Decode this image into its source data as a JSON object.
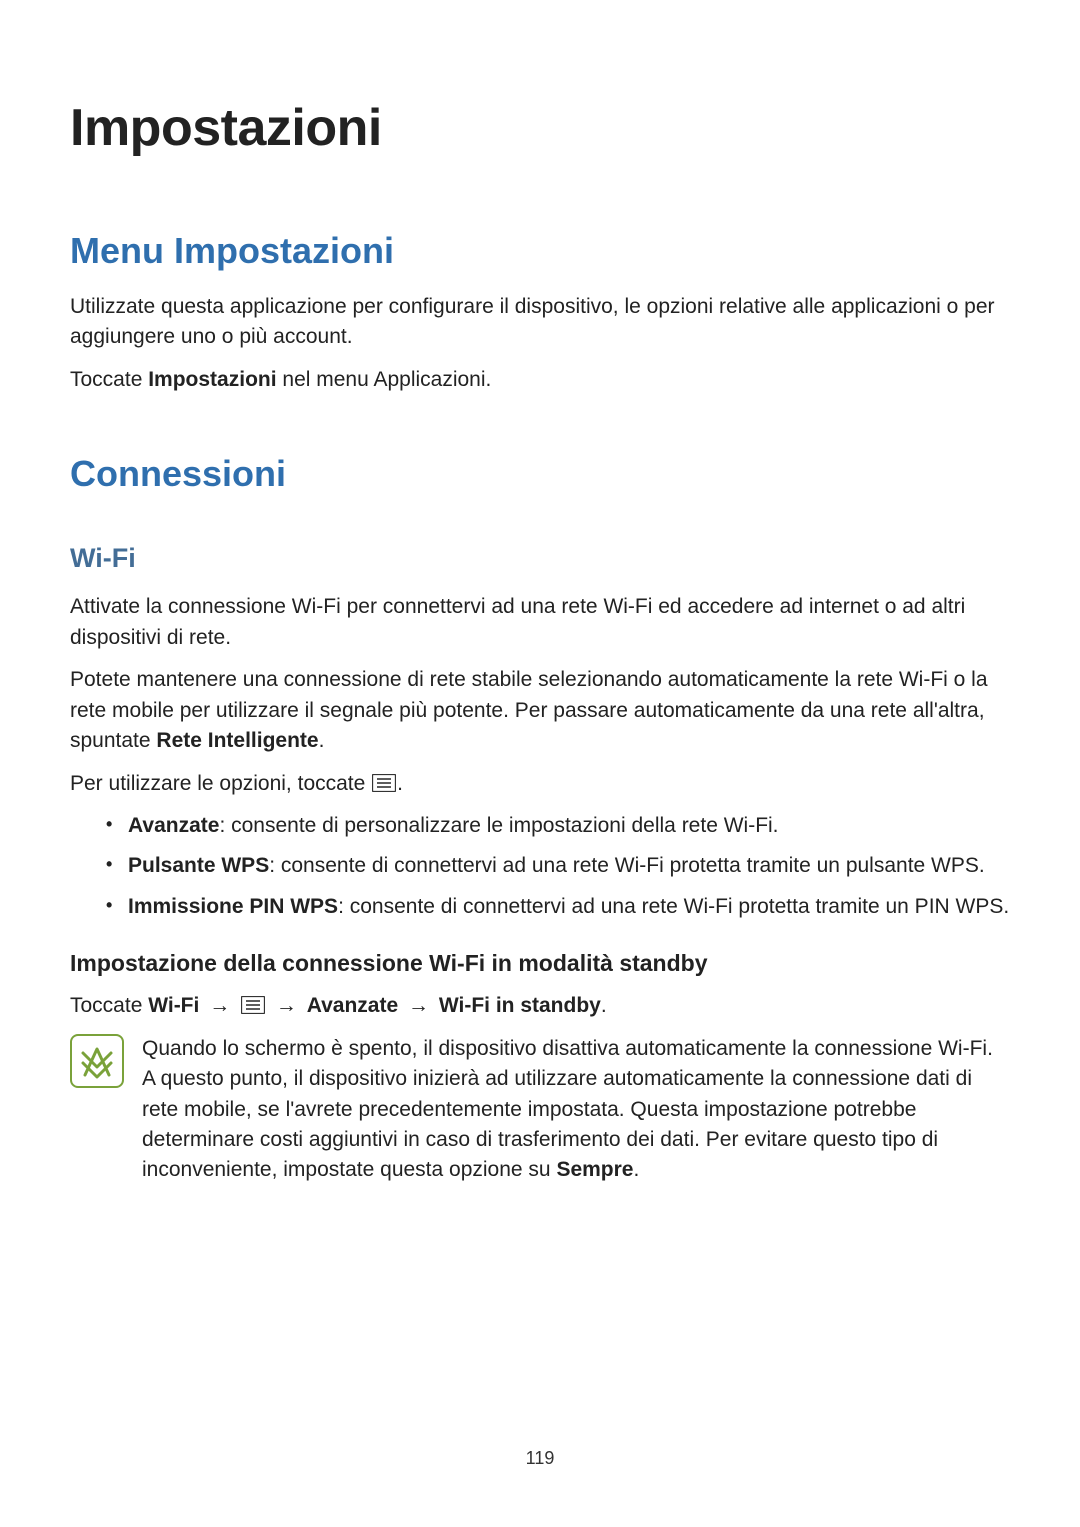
{
  "title": "Impostazioni",
  "menu": {
    "heading": "Menu Impostazioni",
    "p1": "Utilizzate questa applicazione per configurare il dispositivo, le opzioni relative alle applicazioni o per aggiungere uno o più account.",
    "p2_pre": "Toccate ",
    "p2_bold": "Impostazioni",
    "p2_post": " nel menu Applicazioni."
  },
  "conn": {
    "heading": "Connessioni",
    "wifi": {
      "heading": "Wi-Fi",
      "p1": "Attivate la connessione Wi-Fi per connettervi ad una rete Wi-Fi ed accedere ad internet o ad altri dispositivi di rete.",
      "p2_pre": "Potete mantenere una connessione di rete stabile selezionando automaticamente la rete Wi-Fi o la rete mobile per utilizzare il segnale più potente. Per passare automaticamente da una rete all'altra, spuntate ",
      "p2_bold": "Rete Intelligente",
      "p2_post": ".",
      "p3_pre": "Per utilizzare le opzioni, toccate ",
      "p3_post": ".",
      "bullets": [
        {
          "label": "Avanzate",
          "text": ": consente di personalizzare le impostazioni della rete Wi-Fi."
        },
        {
          "label": "Pulsante WPS",
          "text": ": consente di connettervi ad una rete Wi-Fi protetta tramite un pulsante WPS."
        },
        {
          "label": "Immissione PIN WPS",
          "text": ": consente di connettervi ad una rete Wi-Fi protetta tramite un PIN WPS."
        }
      ],
      "standby": {
        "heading": "Impostazione della connessione Wi-Fi in modalità standby",
        "path_pre": "Toccate ",
        "path_b1": "Wi-Fi",
        "path_b2": "Avanzate",
        "path_b3": "Wi-Fi in standby",
        "arrow": "→",
        "note_pre": "Quando lo schermo è spento, il dispositivo disattiva automaticamente la connessione Wi-Fi. A questo punto, il dispositivo inizierà ad utilizzare automaticamente la connessione dati di rete mobile, se l'avrete precedentemente impostata. Questa impostazione potrebbe determinare costi aggiuntivi in caso di trasferimento dei dati. Per evitare questo tipo di inconveniente, impostate questa opzione su ",
        "note_bold": "Sempre",
        "note_post": "."
      }
    }
  },
  "page_number": "119"
}
